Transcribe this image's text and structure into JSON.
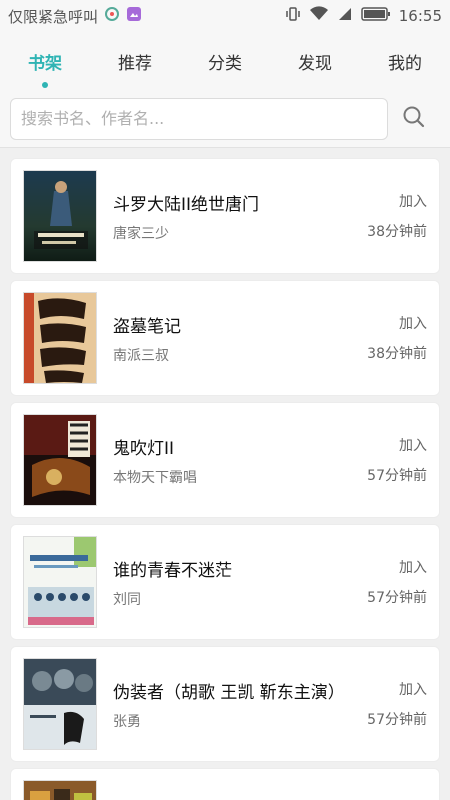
{
  "status": {
    "carrier": "仅限紧急呼叫",
    "time": "16:55"
  },
  "tabs": [
    {
      "label": "书架",
      "active": true
    },
    {
      "label": "推荐",
      "active": false
    },
    {
      "label": "分类",
      "active": false
    },
    {
      "label": "发现",
      "active": false
    },
    {
      "label": "我的",
      "active": false
    }
  ],
  "search": {
    "placeholder": "搜索书名、作者名..."
  },
  "books": [
    {
      "title": "斗罗大陆II绝世唐门",
      "author": "唐家三少",
      "action": "加入",
      "time": "38分钟前"
    },
    {
      "title": "盗墓笔记",
      "author": "南派三叔",
      "action": "加入",
      "time": "38分钟前"
    },
    {
      "title": "鬼吹灯II",
      "author": "本物天下霸唱",
      "action": "加入",
      "time": "57分钟前"
    },
    {
      "title": "谁的青春不迷茫",
      "author": "刘同",
      "action": "加入",
      "time": "57分钟前"
    },
    {
      "title": "伪装者（胡歌 王凯 靳东主演）",
      "author": "张勇",
      "action": "加入",
      "time": "57分钟前"
    }
  ],
  "colors": {
    "accent": "#2fb4b4"
  }
}
